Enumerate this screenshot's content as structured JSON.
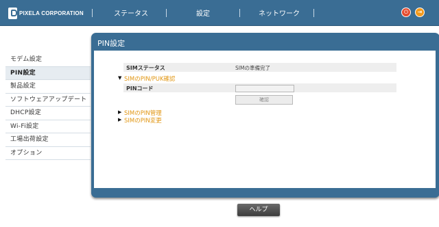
{
  "header": {
    "brand": "PIXELA CORPORATION",
    "nav": [
      "ステータス",
      "設定",
      "ネットワーク"
    ],
    "power_icon": "power-icon",
    "exit_icon": "exit-icon"
  },
  "sidebar": {
    "items": [
      {
        "label": "モデム設定"
      },
      {
        "label": "PIN設定"
      },
      {
        "label": "製品設定"
      },
      {
        "label": "ソフトウェアアップデート"
      },
      {
        "label": "DHCP設定"
      },
      {
        "label": "Wi-Fi設定"
      },
      {
        "label": "工場出荷設定"
      },
      {
        "label": "オプション"
      }
    ]
  },
  "panel": {
    "title": "PIN設定",
    "sim_status_label": "SIMステータス",
    "sim_status_value": "SIMの準備完了",
    "pin_puk_link": "SIMのPIN/PUK確認",
    "pin_code_label": "PINコード",
    "pin_code_value": "",
    "confirm_button": "確認",
    "pin_manage_link": "SIMのPIN管理",
    "pin_change_link": "SIMのPIN変更"
  },
  "help_button": "ヘルプ"
}
